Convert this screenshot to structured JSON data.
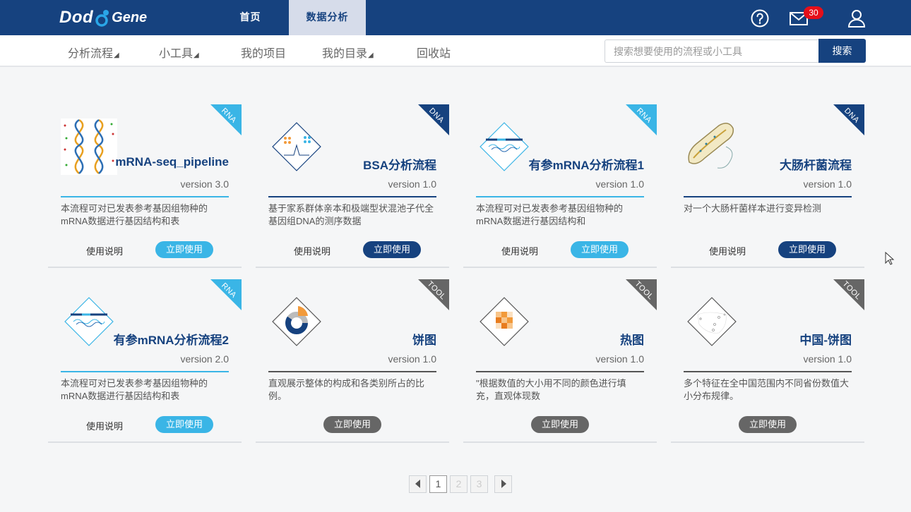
{
  "brand": {
    "logo_left": "Dod",
    "logo_right": "Gene"
  },
  "topnav": [
    {
      "label": "首页",
      "active": false
    },
    {
      "label": "数据分析",
      "active": true
    }
  ],
  "header": {
    "message_count": "30"
  },
  "subnav": [
    {
      "label": "分析流程",
      "dropdown": true
    },
    {
      "label": "小工具",
      "dropdown": true
    },
    {
      "label": "我的项目",
      "dropdown": false
    },
    {
      "label": "我的目录",
      "dropdown": true
    },
    {
      "label": "回收站",
      "dropdown": false
    }
  ],
  "search": {
    "placeholder": "搜索想要使用的流程或小工具",
    "button": "搜索"
  },
  "colors": {
    "brand": "#16427f",
    "rna": "#3ab5e6",
    "dna": "#16427f",
    "tool": "#666666"
  },
  "cards": [
    {
      "title": "mRNA-seq_pipeline",
      "version": "version 3.0",
      "tag": "RNA",
      "icon": "dna-helix-icon",
      "desc": "本流程可对已发表参考基因组物种的mRNA数据进行基因结构和表",
      "help": "使用说明",
      "use": "立即使用"
    },
    {
      "title": "BSA分析流程",
      "version": "version 1.0",
      "tag": "DNA",
      "icon": "bsa-plot-icon",
      "desc": "基于家系群体亲本和极端型状混池子代全基因组DNA的测序数据",
      "help": "使用说明",
      "use": "立即使用"
    },
    {
      "title": "有参mRNA分析流程1",
      "version": "version 1.0",
      "tag": "RNA",
      "icon": "read-alignment-icon",
      "desc": "本流程可对已发表参考基因组物种的mRNA数据进行基因结构和",
      "help": "使用说明",
      "use": "立即使用"
    },
    {
      "title": "大肠杆菌流程",
      "version": "version 1.0",
      "tag": "DNA",
      "icon": "bacteria-icon",
      "desc": "对一个大肠杆菌样本进行变异检测",
      "help": "使用说明",
      "use": "立即使用"
    },
    {
      "title": "有参mRNA分析流程2",
      "version": "version 2.0",
      "tag": "RNA",
      "icon": "read-alignment-icon",
      "desc": "本流程可对已发表参考基因组物种的mRNA数据进行基因结构和表",
      "help": "使用说明",
      "use": "立即使用"
    },
    {
      "title": "饼图",
      "version": "version 1.0",
      "tag": "TOOL",
      "icon": "donut-chart-icon",
      "desc": "直观展示整体的构成和各类别所占的比例。",
      "help": "",
      "use": "立即使用"
    },
    {
      "title": "热图",
      "version": "version 1.0",
      "tag": "TOOL",
      "icon": "heatmap-icon",
      "desc": "\"根据数值的大小用不同的颜色进行填充，直观体现数",
      "help": "",
      "use": "立即使用"
    },
    {
      "title": "中国-饼图",
      "version": "version 1.0",
      "tag": "TOOL",
      "icon": "china-map-icon",
      "desc": "多个特征在全中国范围内不同省份数值大小分布规律。",
      "help": "",
      "use": "立即使用"
    }
  ],
  "pagination": {
    "pages": [
      "1",
      "2",
      "3"
    ],
    "current": "1"
  }
}
